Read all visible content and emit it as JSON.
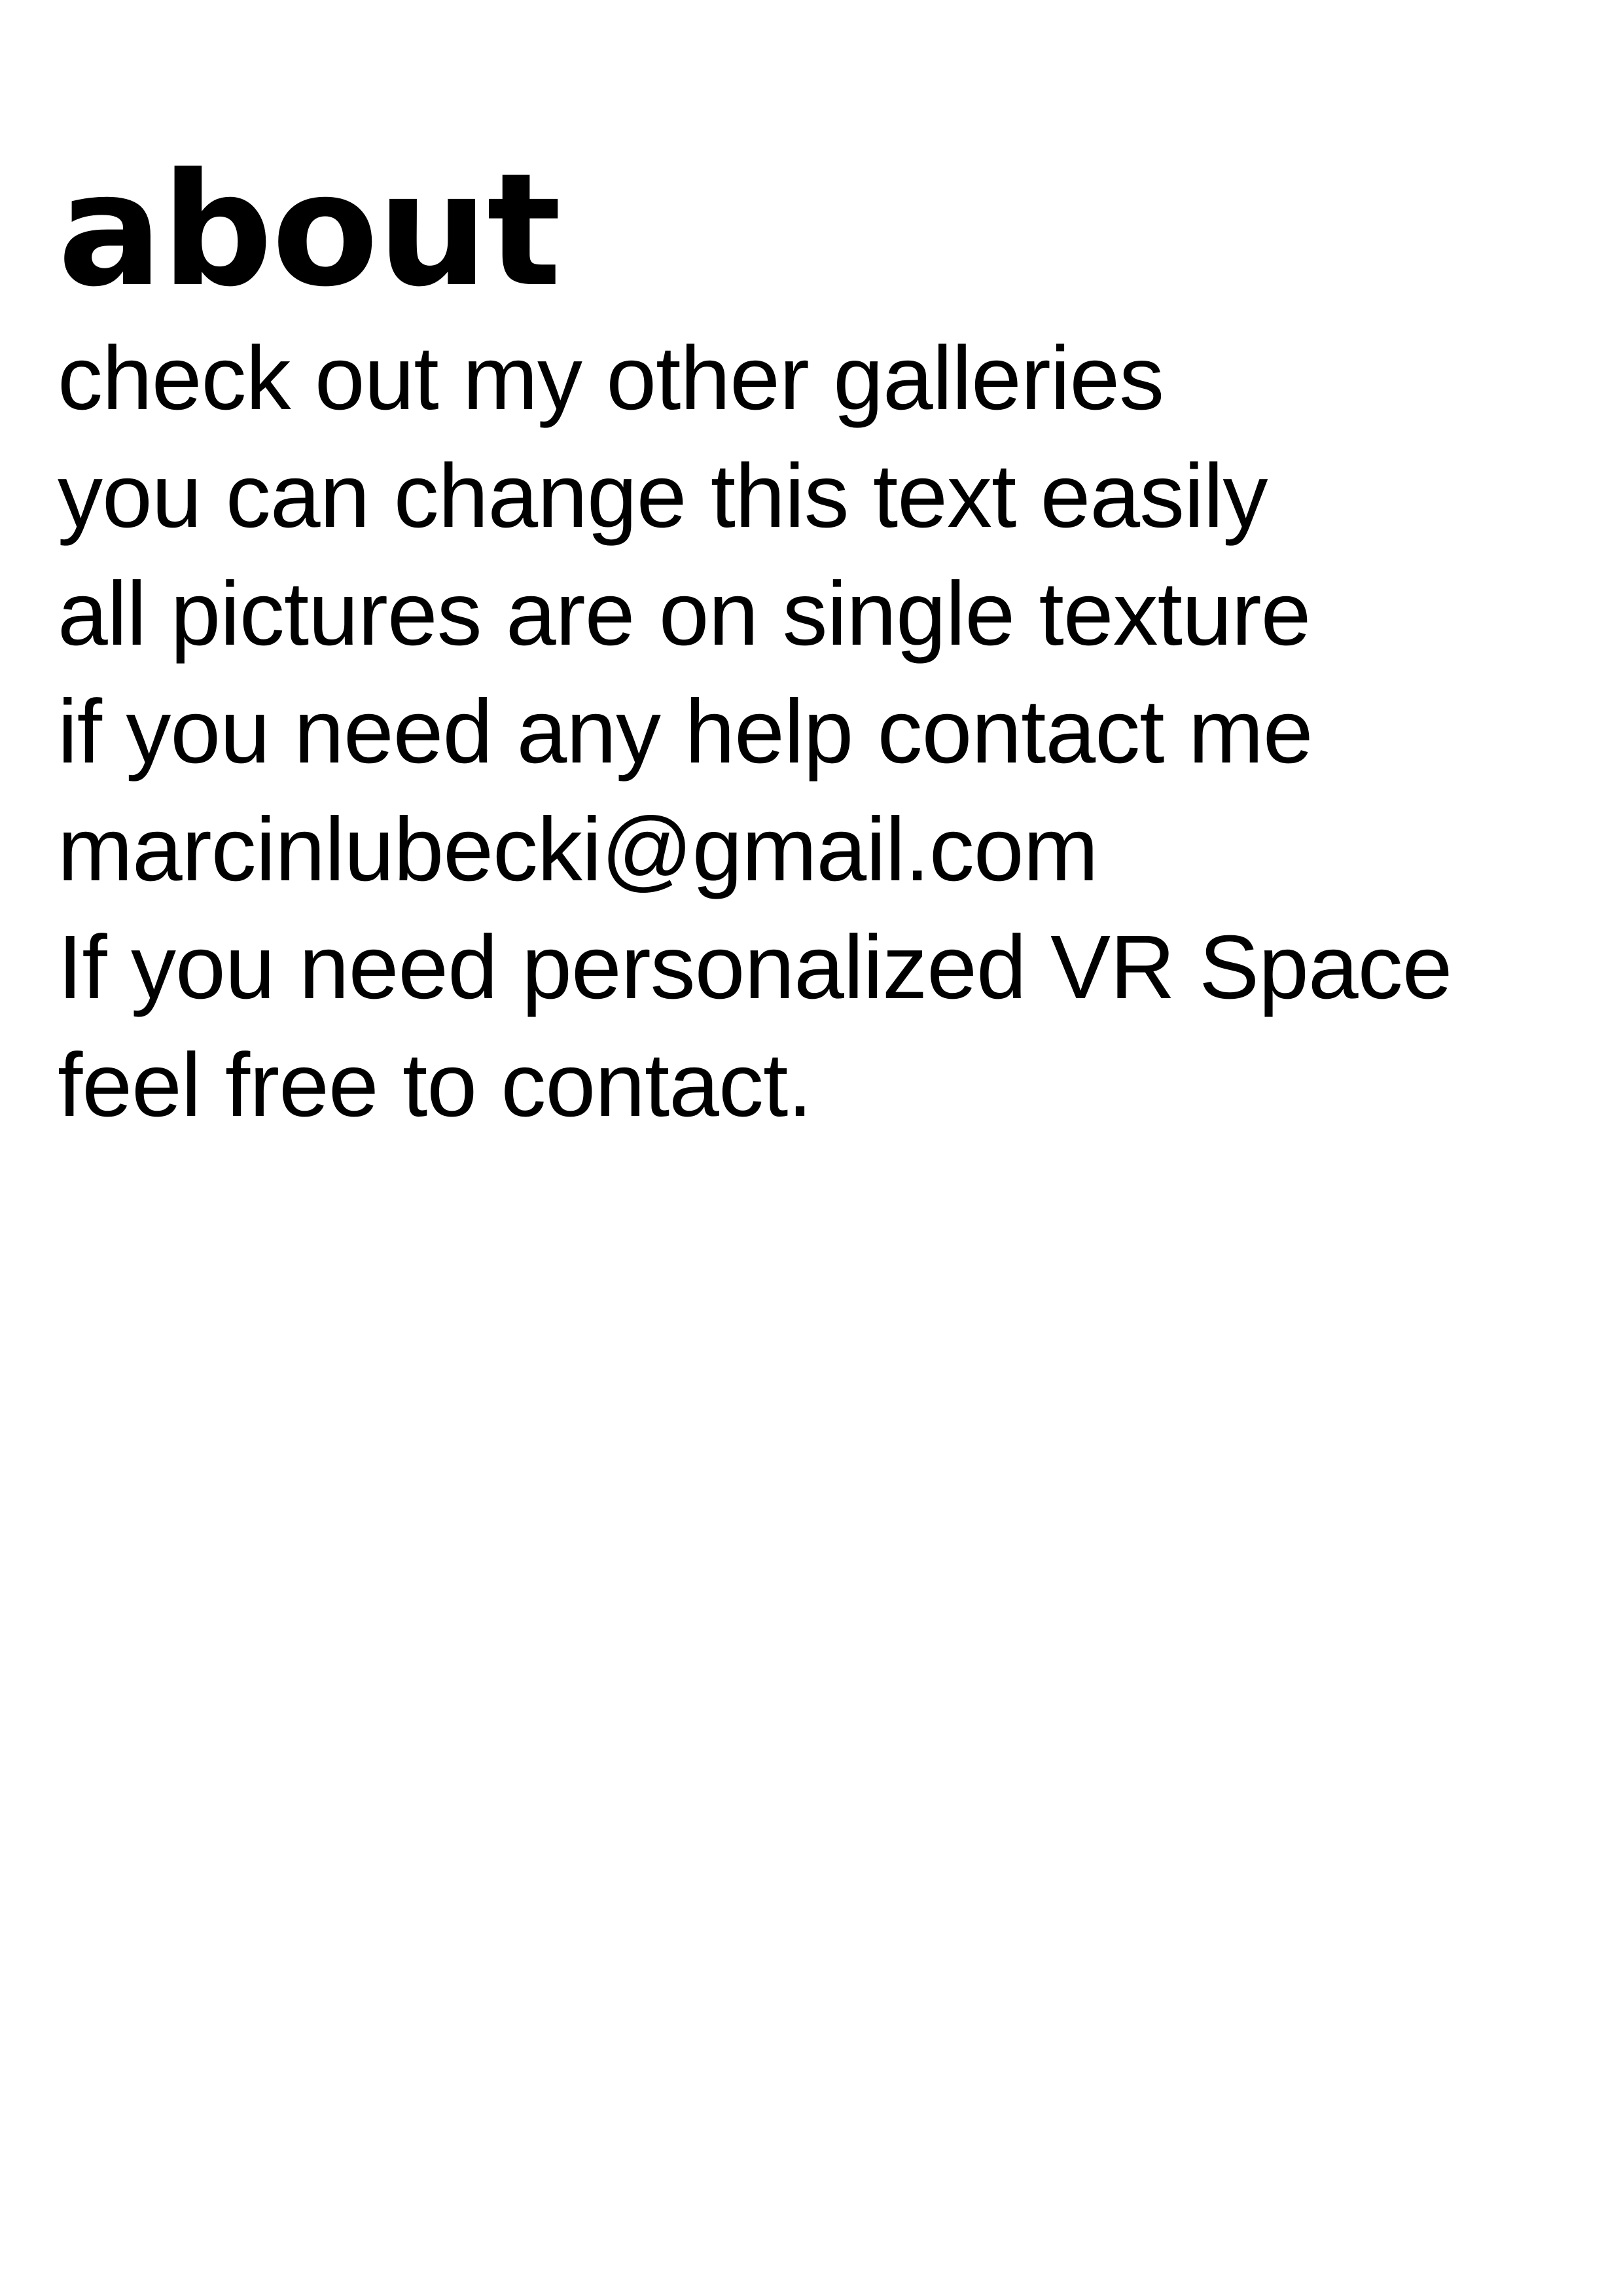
{
  "document": {
    "title": "about",
    "lines": [
      "check out my other galleries",
      "you can change this text easily",
      "all pictures are on single texture",
      "if you need any help contact me",
      "marcinlubecki@gmail.com",
      "If you need personalized VR Space",
      "feel free to contact."
    ]
  }
}
